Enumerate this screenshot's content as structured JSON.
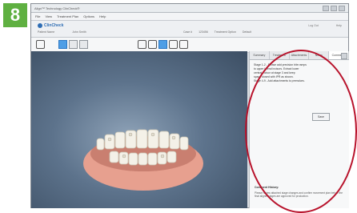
{
  "step_badge": "8",
  "window": {
    "title": "Align™ Technology ClinCheck®",
    "menu": [
      "File",
      "View",
      "Treatment Plan",
      "Options",
      "Help"
    ]
  },
  "appbar": {
    "brand": "ClinCheck",
    "patient_label": "Patient Name",
    "patient_name": "John Smith",
    "case_label": "Case #",
    "case_value": "123456",
    "treatment_label": "Treatment Option",
    "treatment_value": "Default",
    "links": [
      "Log Out",
      "Help"
    ]
  },
  "sidepanel": {
    "tabs": [
      "Summary",
      "Treatment",
      "Attachments",
      "Notes",
      "Comments"
    ],
    "active_tab": 4,
    "notes_lines": [
      "Stage 1-2 - Please add precision bite ramps",
      "to upper lateral incisors. Extract lower",
      "central incisor at stage 3 and keep",
      "space closed with IPR as shown.",
      "Stage 4-9 - Add attachments to premolars."
    ],
    "ok_label": "Save",
    "history_label": "Comment History:",
    "history_text": "Please review attached stage changes and confirm movement plan before the final aligner stages are approved for production."
  }
}
